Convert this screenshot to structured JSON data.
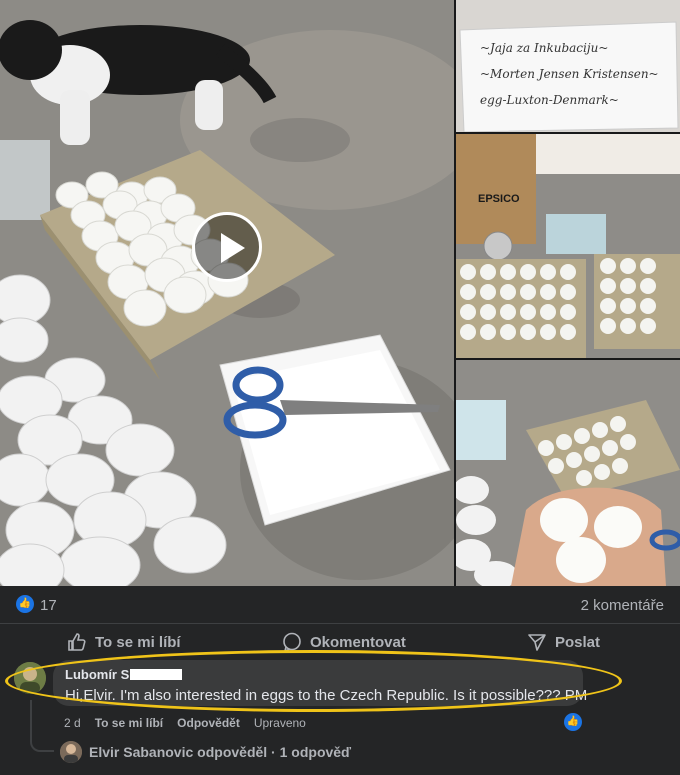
{
  "post": {
    "note_lines": [
      "~Jaja za Inkubaciju~",
      "~Morten Jensen Kristensen~",
      "egg-Luxton-Denmark~"
    ],
    "box_label": "EPSICO",
    "colors": {
      "background": "#242526",
      "accent_blue": "#1b74e4",
      "highlight_ellipse": "#f0c419"
    }
  },
  "stats": {
    "reaction_icon": "thumbs-up-icon",
    "likes": "17",
    "comments": "2 komentáře"
  },
  "actions": {
    "like_label": "To se mi líbí",
    "comment_label": "Okomentovat",
    "share_label": "Poslat"
  },
  "comment": {
    "author": "Lubomír S",
    "text": "Hi,Elvir. I'm also interested in eggs to the Czech Republic. Is it possible??? PM",
    "time": "2 d",
    "like_label": "To se mi líbí",
    "reply_label": "Odpovědět",
    "edited_label": "Upraveno"
  },
  "reply_summary": {
    "text": "Elvir Sabanovic odpověděl · 1 odpověď"
  }
}
